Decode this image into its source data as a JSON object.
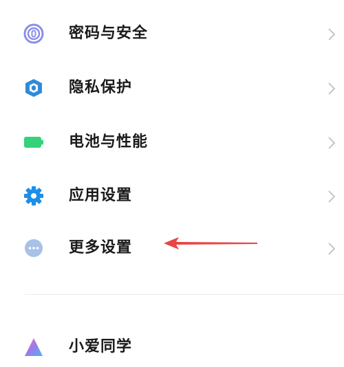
{
  "menu": {
    "items": [
      {
        "label": "密码与安全",
        "icon": "fingerprint-icon",
        "color": "#8b8ee8"
      },
      {
        "label": "隐私保护",
        "icon": "shield-icon",
        "color": "#2f8bd9"
      },
      {
        "label": "电池与性能",
        "icon": "battery-icon",
        "color": "#35d27a"
      },
      {
        "label": "应用设置",
        "icon": "gear-icon",
        "color": "#1c8fe8"
      },
      {
        "label": "更多设置",
        "icon": "more-dots-icon",
        "color": "#a9c1e6"
      },
      {
        "label": "小爱同学",
        "icon": "xiaoai-icon",
        "color": "#9a7bea"
      }
    ]
  },
  "annotation": {
    "arrow_color": "#e84545"
  }
}
